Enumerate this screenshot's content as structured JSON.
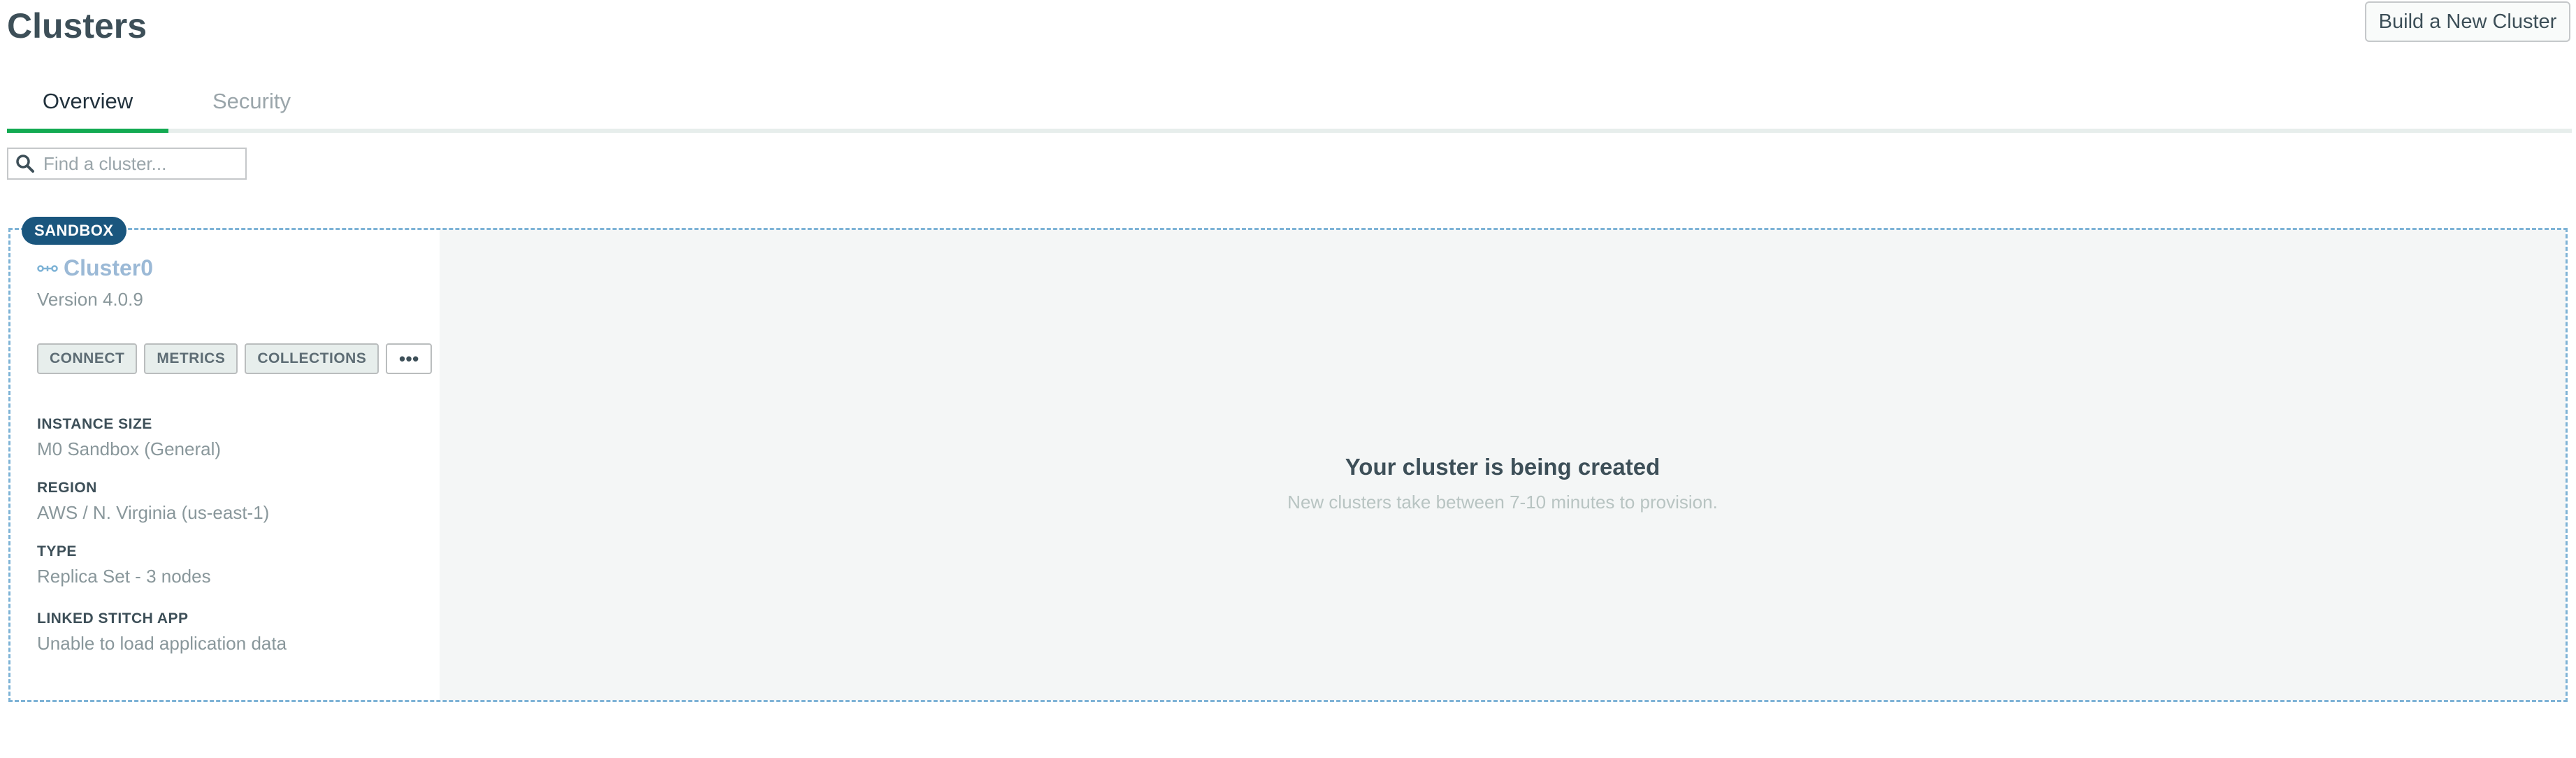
{
  "header": {
    "title": "Clusters",
    "build_button_label": "Build a New Cluster"
  },
  "tabs": [
    {
      "label": "Overview",
      "active": true
    },
    {
      "label": "Security",
      "active": false
    }
  ],
  "search": {
    "placeholder": "Find a cluster...",
    "value": "",
    "icon": "search-icon"
  },
  "cluster": {
    "badge": "SANDBOX",
    "icon": "cluster-icon",
    "name": "Cluster0",
    "version": "Version 4.0.9",
    "actions": {
      "connect": "CONNECT",
      "metrics": "METRICS",
      "collections": "COLLECTIONS",
      "more": "•••"
    },
    "info": [
      {
        "label": "INSTANCE SIZE",
        "value": "M0 Sandbox (General)"
      },
      {
        "label": "REGION",
        "value": "AWS / N. Virginia (us-east-1)"
      },
      {
        "label": "TYPE",
        "value": "Replica Set - 3 nodes"
      },
      {
        "label": "LINKED STITCH APP",
        "value": "Unable to load application data"
      }
    ],
    "status": {
      "title": "Your cluster is being created",
      "subtitle": "New clusters take between 7-10 minutes to provision."
    }
  },
  "colors": {
    "accent_green": "#13aa52",
    "badge_blue": "#1a567e",
    "cluster_link": "#9bb9d6",
    "card_border": "#7eb3d6"
  }
}
